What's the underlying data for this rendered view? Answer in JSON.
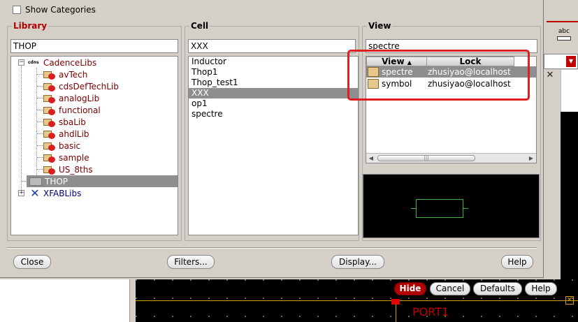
{
  "dialog": {
    "show_categories": "Show Categories",
    "library": {
      "title": "Library",
      "filter": "THOP",
      "tree": [
        {
          "label": "CadenceLibs",
          "icon": "cds-icon",
          "expanded": true
        },
        {
          "label": "avTech"
        },
        {
          "label": "cdsDefTechLib"
        },
        {
          "label": "analogLib"
        },
        {
          "label": "functional"
        },
        {
          "label": "sbaLib"
        },
        {
          "label": "ahdlLib"
        },
        {
          "label": "basic"
        },
        {
          "label": "sample"
        },
        {
          "label": "US_8ths"
        },
        {
          "label": "THOP",
          "selected": true
        },
        {
          "label": "XFABLibs",
          "icon": "xfab-icon"
        }
      ]
    },
    "cell": {
      "title": "Cell",
      "filter": "XXX",
      "items": [
        "Inductor",
        "Thop1",
        "Thop_test1",
        "XXX",
        "op1",
        "spectre"
      ],
      "selected": "XXX"
    },
    "view": {
      "title": "View",
      "filter": "spectre",
      "columns": [
        "View",
        "Lock"
      ],
      "rows": [
        {
          "view": "spectre",
          "lock": "zhusiyao@localhost",
          "selected": true
        },
        {
          "view": "symbol",
          "lock": "zhusiyao@localhost",
          "selected": false
        }
      ]
    },
    "buttons": {
      "close": "Close",
      "filters": "Filters...",
      "display": "Display...",
      "help": "Help"
    }
  },
  "background": {
    "abc_label": "abc",
    "port_label": "PORT1",
    "buttons": {
      "hide": "Hide",
      "cancel": "Cancel",
      "defaults": "Defaults",
      "help": "Help"
    }
  },
  "colors": {
    "accent_red": "#b00000",
    "selection_gray": "#8e8e8e",
    "highlight_red": "#e02020"
  }
}
